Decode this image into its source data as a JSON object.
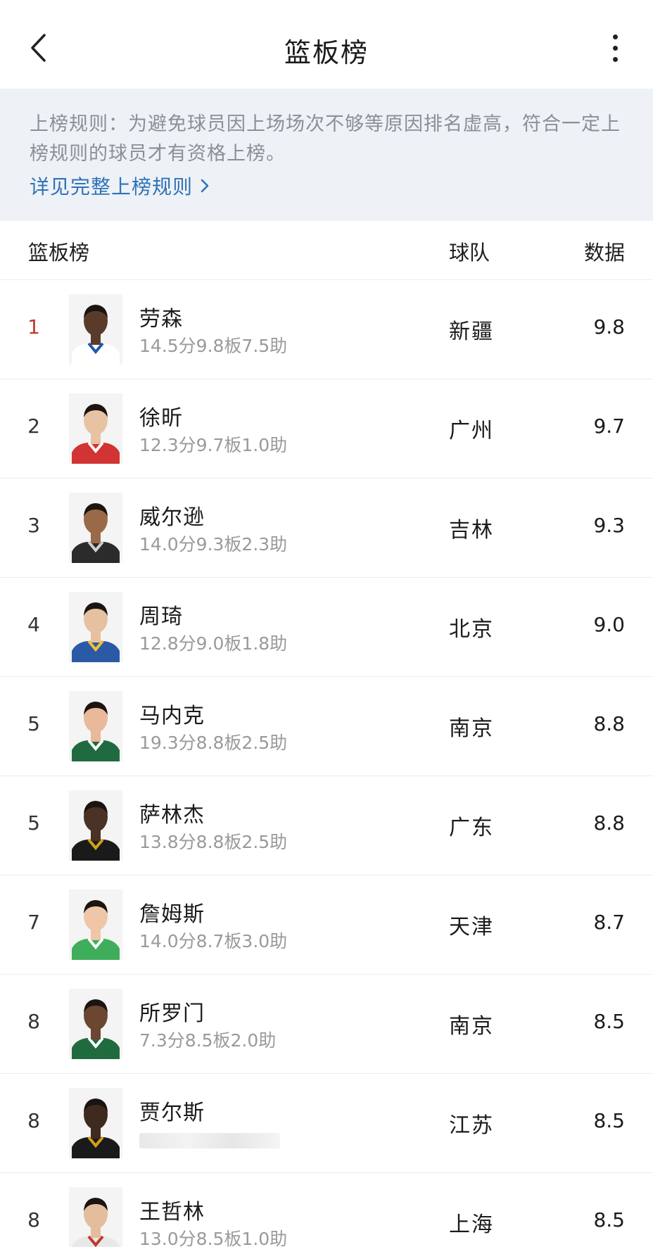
{
  "topbar": {
    "title": "篮板榜"
  },
  "rules": {
    "text": "上榜规则：为避免球员因上场场次不够等原因排名虚高，符合一定上榜规则的球员才有资格上榜。",
    "link_label": "详见完整上榜规则"
  },
  "table_header": {
    "rank_label": "篮板榜",
    "team_label": "球队",
    "value_label": "数据"
  },
  "players": [
    {
      "rank": "1",
      "name": "劳森",
      "stats": "14.5分9.8板7.5助",
      "team": "新疆",
      "value": "9.8",
      "skin": "#5a3b2a",
      "jersey": "#ffffff",
      "trim": "#1e5aa8"
    },
    {
      "rank": "2",
      "name": "徐昕",
      "stats": "12.3分9.7板1.0助",
      "team": "广州",
      "value": "9.7",
      "skin": "#e8c3a3",
      "jersey": "#d23333",
      "trim": "#ffffff"
    },
    {
      "rank": "3",
      "name": "威尔逊",
      "stats": "14.0分9.3板2.3助",
      "team": "吉林",
      "value": "9.3",
      "skin": "#9a6a48",
      "jersey": "#2b2b2b",
      "trim": "#cfcfcf"
    },
    {
      "rank": "4",
      "name": "周琦",
      "stats": "12.8分9.0板1.8助",
      "team": "北京",
      "value": "9.0",
      "skin": "#e6c19f",
      "jersey": "#2a5aa6",
      "trim": "#f2c12e"
    },
    {
      "rank": "5",
      "name": "马内克",
      "stats": "19.3分8.8板2.5助",
      "team": "南京",
      "value": "8.8",
      "skin": "#e9b99a",
      "jersey": "#1f6b3f",
      "trim": "#ffffff"
    },
    {
      "rank": "5",
      "name": "萨林杰",
      "stats": "13.8分8.8板2.5助",
      "team": "广东",
      "value": "8.8",
      "skin": "#4a3224",
      "jersey": "#1a1a1a",
      "trim": "#d4a017"
    },
    {
      "rank": "7",
      "name": "詹姆斯",
      "stats": "14.0分8.7板3.0助",
      "team": "天津",
      "value": "8.7",
      "skin": "#efc6a8",
      "jersey": "#3fae5c",
      "trim": "#ffffff"
    },
    {
      "rank": "8",
      "name": "所罗门",
      "stats": "7.3分8.5板2.0助",
      "team": "南京",
      "value": "8.5",
      "skin": "#6b4631",
      "jersey": "#1f6b3f",
      "trim": "#ffffff"
    },
    {
      "rank": "8",
      "name": "贾尔斯",
      "stats": "",
      "team": "江苏",
      "value": "8.5",
      "skin": "#3e2a1f",
      "jersey": "#1a1a1a",
      "trim": "#d4a017"
    },
    {
      "rank": "8",
      "name": "王哲林",
      "stats": "13.0分8.5板1.0助",
      "team": "上海",
      "value": "8.5",
      "skin": "#e3bd9c",
      "jersey": "#e8e8e8",
      "trim": "#c0392b"
    }
  ],
  "colors": {
    "accent_link": "#2e73b8",
    "top_rank": "#c0392b",
    "rules_bg": "#eef1f5"
  }
}
